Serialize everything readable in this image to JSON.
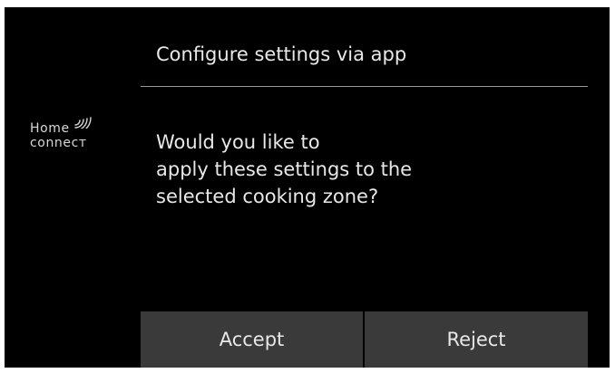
{
  "logo": {
    "line1": "Home",
    "line2": "connecт",
    "icon": "wifi-signal-icon"
  },
  "dialog": {
    "title": "Configure settings via app",
    "message_lines": [
      "Would you like to",
      "apply these settings to the",
      "selected cooking zone?"
    ],
    "accept_label": "Accept",
    "reject_label": "Reject"
  },
  "colors": {
    "background": "#000000",
    "text": "#e8e8e8",
    "button_bg": "#3a3a3a",
    "divider": "#9a9a9a"
  }
}
